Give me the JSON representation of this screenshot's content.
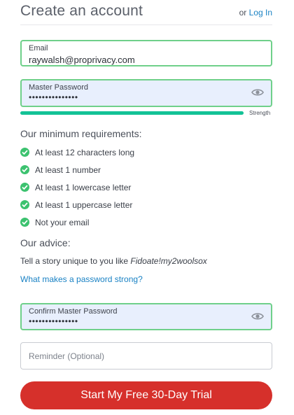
{
  "header": {
    "title": "Create an account",
    "or_text": "or",
    "login_link": "Log In"
  },
  "email_field": {
    "label": "Email",
    "value": "raywalsh@proprivacy.com"
  },
  "password_field": {
    "label": "Master Password",
    "value_masked": "•••••••••••••••",
    "eye_icon": "eye-icon"
  },
  "strength": {
    "label": "Strength",
    "level_fraction": 1.0,
    "color": "#13c296"
  },
  "requirements": {
    "heading": "Our minimum requirements:",
    "items": [
      {
        "label": "At least 12 characters long",
        "met": true
      },
      {
        "label": "At least 1 number",
        "met": true
      },
      {
        "label": "At least 1 lowercase letter",
        "met": true
      },
      {
        "label": "At least 1 uppercase letter",
        "met": true
      },
      {
        "label": "Not your email",
        "met": true
      }
    ]
  },
  "advice": {
    "heading": "Our advice:",
    "text_prefix": "Tell a story unique to you like ",
    "example": "Fidoate!my2woolsox",
    "link": "What makes a password strong?"
  },
  "confirm_field": {
    "label": "Confirm Master Password",
    "value_masked": "•••••••••••••••",
    "eye_icon": "eye-icon"
  },
  "reminder_field": {
    "placeholder": "Reminder (Optional)"
  },
  "cta": {
    "label": "Start My Free 30-Day Trial",
    "color": "#d6302b"
  },
  "colors": {
    "valid_border": "#6fd08a",
    "check_green": "#3cc26f",
    "link_blue": "#1a82c4",
    "field_fill_blue": "#e8effd"
  }
}
